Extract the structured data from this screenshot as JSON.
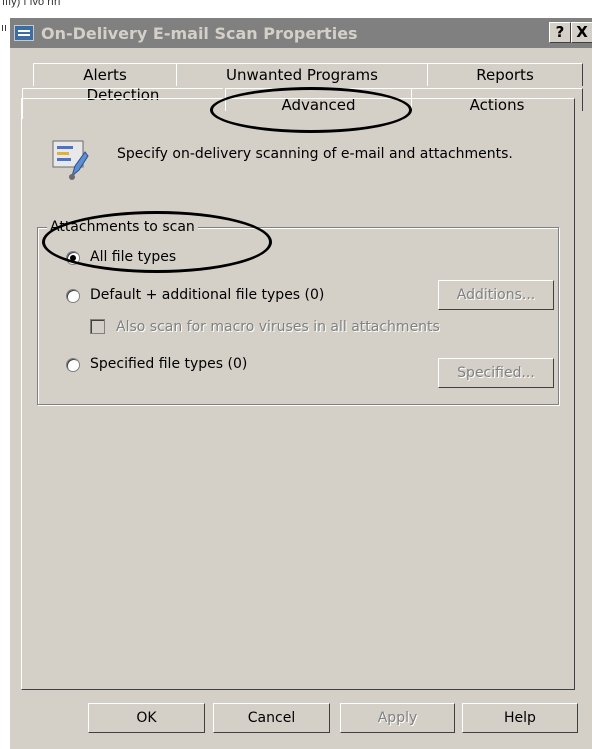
{
  "edge": {
    "top_text": "ıııy) ı ıvo rırı"
  },
  "window": {
    "title": "On-Delivery E-mail Scan Properties",
    "help_button": "?",
    "close_button": "X"
  },
  "tabs": {
    "back_row": [
      "Alerts",
      "Unwanted Programs",
      "Reports"
    ],
    "front_row": [
      "Detection",
      "Advanced",
      "Actions"
    ]
  },
  "description": "Specify on-delivery scanning of e-mail and attachments.",
  "attachments_group": {
    "label": "Attachments to scan",
    "all_types": "All file types",
    "default_additional": "Default + additional file types (0)",
    "additions_button": "Additions...",
    "macro_check": "Also scan for macro viruses in all attachments",
    "specified_types": "Specified file types (0)",
    "specified_button": "Specified..."
  },
  "footer": {
    "ok": "OK",
    "cancel": "Cancel",
    "apply": "Apply",
    "help": "Help"
  },
  "colors": {
    "dialog_bg": "#d4d0c8",
    "titlebar_inactive": "#808080"
  }
}
